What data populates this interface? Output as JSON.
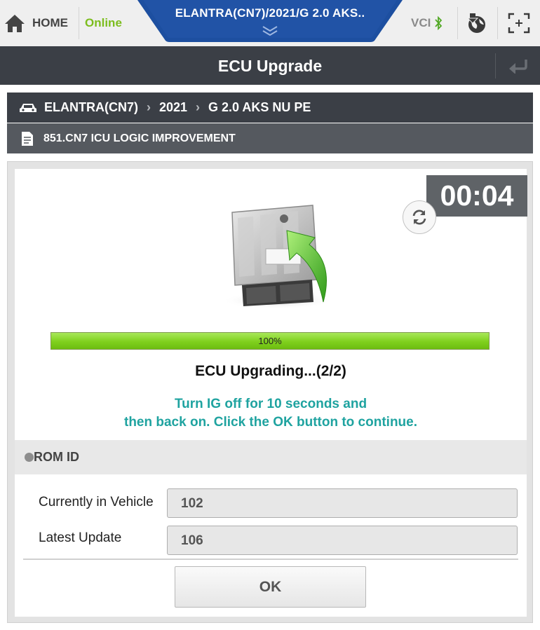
{
  "topbar": {
    "home_label": "HOME",
    "connection_status": "Online",
    "vehicle_title": "ELANTRA(CN7)/2021/G 2.0 AKS..",
    "vci_label": "VCI"
  },
  "titlebar": {
    "title": "ECU Upgrade"
  },
  "breadcrumb": {
    "model": "ELANTRA(CN7)",
    "year": "2021",
    "engine": "G 2.0 AKS NU PE"
  },
  "subheader": {
    "procedure": "851.CN7 ICU LOGIC IMPROVEMENT"
  },
  "upgrade": {
    "timer": "00:04",
    "progress_percent": 100,
    "progress_label": "100%",
    "status_text": "ECU Upgrading...(2/2)",
    "instruction_line1": "Turn IG off for 10 seconds and",
    "instruction_line2": "then back on. Click the OK button to continue."
  },
  "rom": {
    "section_title": "ROM ID",
    "current_label": "Currently in Vehicle",
    "current_value": "102",
    "latest_label": "Latest Update",
    "latest_value": "106"
  },
  "actions": {
    "ok_label": "OK"
  },
  "colors": {
    "header_dark": "#3b3f46",
    "online_green": "#7cbd1e",
    "tab_blue": "#1d4fa0",
    "instruction_teal": "#1fa3a0",
    "progress_green": "#7fd01d"
  }
}
